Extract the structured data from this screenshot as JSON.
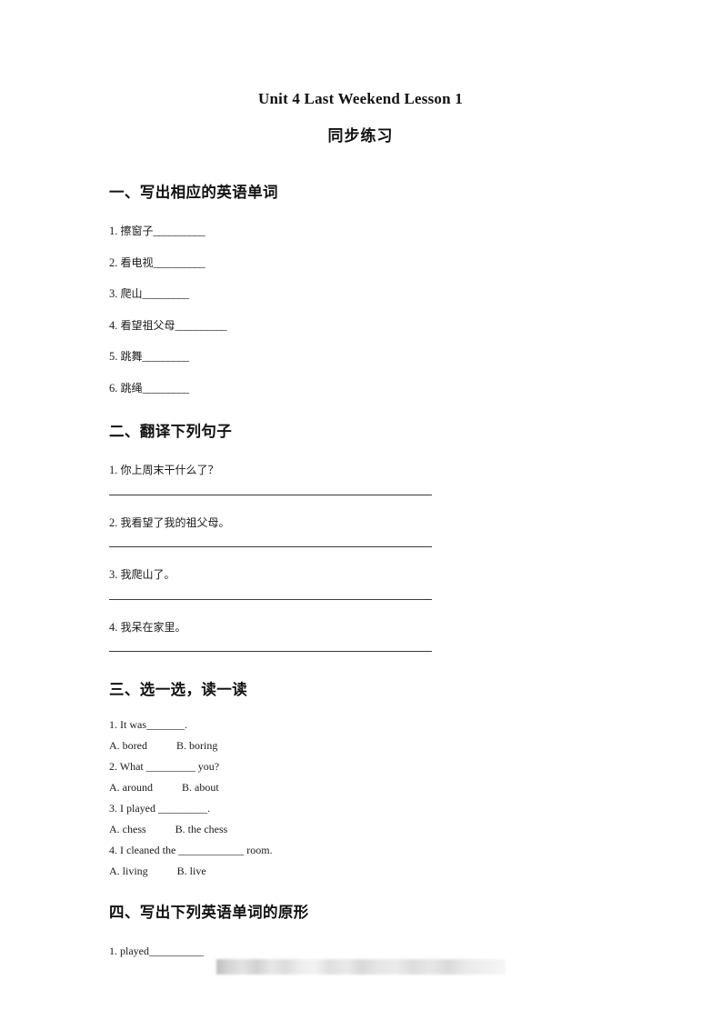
{
  "document": {
    "title": "Unit 4 Last Weekend Lesson 1",
    "subtitle": "同步练习"
  },
  "sections": {
    "one": {
      "heading": "一、写出相应的英语单词",
      "items": [
        {
          "num": "1.",
          "cn": "擦窗子",
          "blank": "__________"
        },
        {
          "num": "2.",
          "cn": "看电视",
          "blank": "__________"
        },
        {
          "num": "3.",
          "cn": "爬山",
          "blank": "_________"
        },
        {
          "num": "4.",
          "cn": "看望祖父母",
          "blank": "__________"
        },
        {
          "num": "5.",
          "cn": "跳舞",
          "blank": "_________"
        },
        {
          "num": "6.",
          "cn": "跳绳",
          "blank": "_________"
        }
      ]
    },
    "two": {
      "heading": "二、翻译下列句子",
      "items": [
        {
          "num": "1.",
          "cn": "你上周末干什么了？"
        },
        {
          "num": "2.",
          "cn": "我看望了我的祖父母。"
        },
        {
          "num": "3.",
          "cn": "我爬山了。"
        },
        {
          "num": "4.",
          "cn": "我呆在家里。"
        }
      ]
    },
    "three": {
      "heading": "三、选一选，读一读",
      "questions": [
        {
          "stem": "1. It was_______.",
          "option_a": "A. bored",
          "option_b": "B. boring"
        },
        {
          "stem": "2. What _________ you?",
          "option_a": "A. around",
          "option_b": "B. about"
        },
        {
          "stem": "3. I played _________.",
          "option_a": "A. chess",
          "option_b": "B. the chess"
        },
        {
          "stem": "4. I cleaned the ____________ room.",
          "option_a": "A. living",
          "option_b": "B. live"
        }
      ]
    },
    "four": {
      "heading": "四、写出下列英语单词的原形",
      "items": [
        {
          "num": "1.",
          "word": "played",
          "blank": "___________"
        }
      ]
    }
  }
}
